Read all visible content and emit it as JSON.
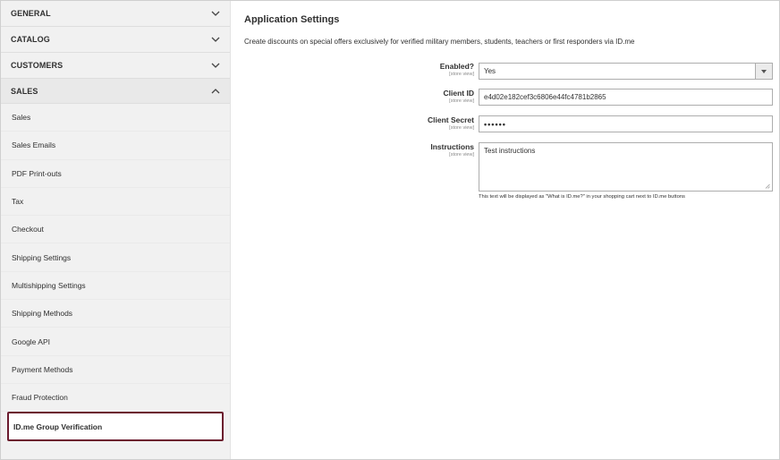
{
  "sidebar": {
    "sections": [
      {
        "title": "GENERAL",
        "state": "collapsed"
      },
      {
        "title": "CATALOG",
        "state": "collapsed"
      },
      {
        "title": "CUSTOMERS",
        "state": "collapsed"
      },
      {
        "title": "SALES",
        "state": "expanded"
      }
    ],
    "sales_items": [
      "Sales",
      "Sales Emails",
      "PDF Print-outs",
      "Tax",
      "Checkout",
      "Shipping Settings",
      "Multishipping Settings",
      "Shipping Methods",
      "Google API",
      "Payment Methods",
      "Fraud Protection",
      "ID.me Group Verification"
    ],
    "active_item": "ID.me Group Verification"
  },
  "main": {
    "title": "Application Settings",
    "description": "Create discounts on special offers exclusively for verified military members, students, teachers or first responders via ID.me",
    "fields": {
      "enabled": {
        "label": "Enabled?",
        "scope": "[store view]",
        "value": "Yes"
      },
      "client_id": {
        "label": "Client ID",
        "scope": "[store view]",
        "value": "e4d02e182cef3c6806e44fc4781b2865"
      },
      "client_secret": {
        "label": "Client Secret",
        "scope": "[store view]",
        "value": "••••••"
      },
      "instructions": {
        "label": "Instructions",
        "scope": "[store view]",
        "value": "Test instructions",
        "note": "This text will be displayed as \"What is ID.me?\" in your shopping cart next to ID.me buttons"
      }
    }
  },
  "colors": {
    "active_border": "#6b1a2e",
    "sidebar_bg": "#f1f1f1"
  },
  "icons": {
    "collapsed": "chevron-down-icon",
    "expanded": "chevron-up-icon",
    "select": "caret-down-icon"
  }
}
